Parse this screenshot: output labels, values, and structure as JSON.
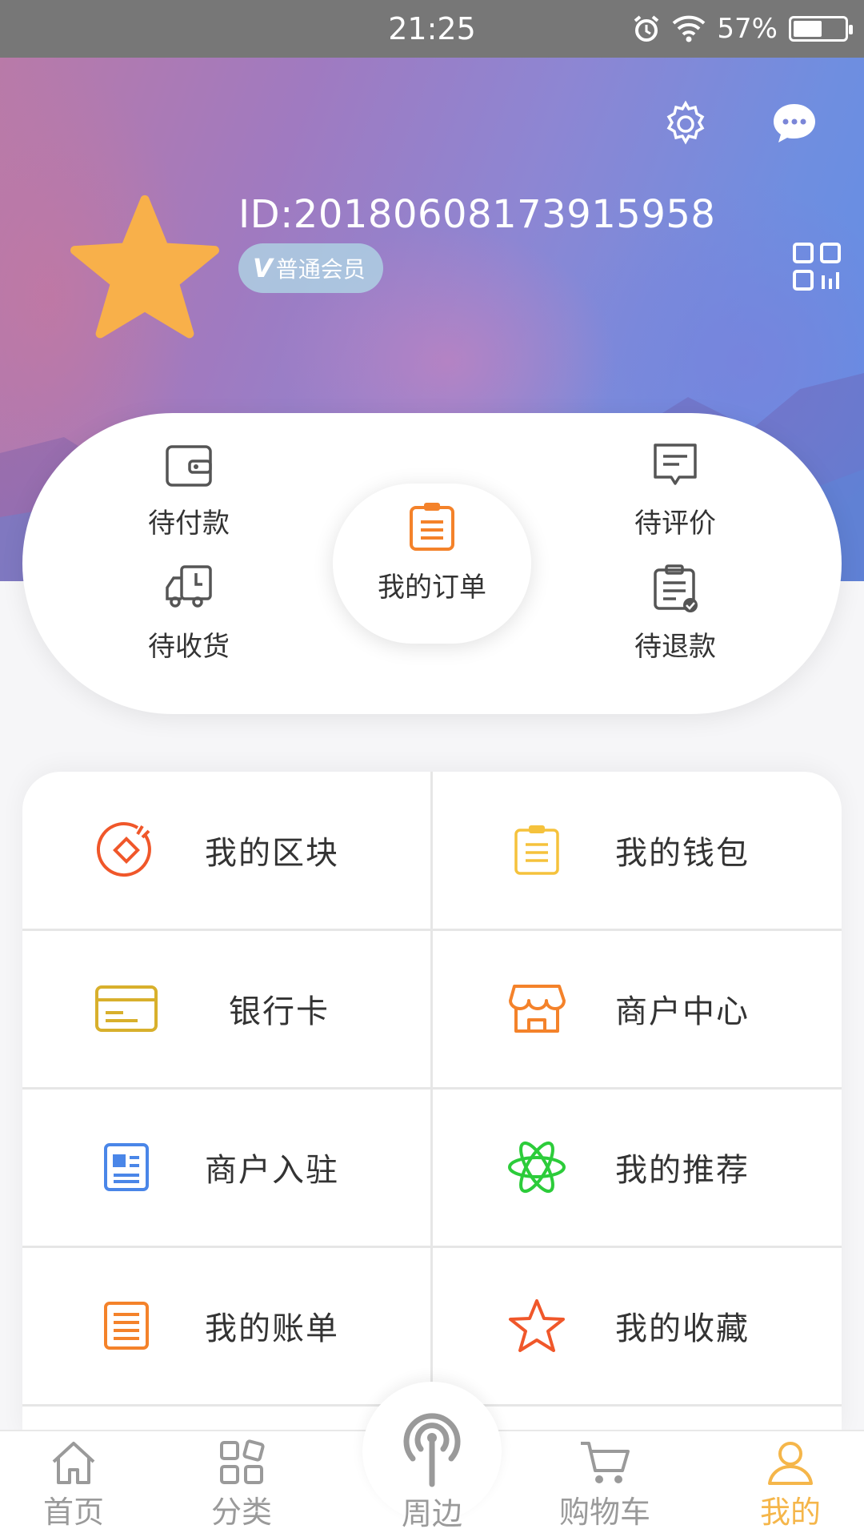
{
  "status_bar": {
    "time": "21:25",
    "battery": "57%",
    "battery_level": 0.57
  },
  "profile": {
    "id": "ID:20180608173915958",
    "member_badge_mark": "V",
    "member_level": "普通会员"
  },
  "orders": {
    "pending_payment": "待付款",
    "pending_review": "待评价",
    "my_orders": "我的订单",
    "pending_receipt": "待收货",
    "pending_refund": "待退款"
  },
  "menu": [
    {
      "label": "我的区块",
      "icon": "block-icon",
      "color": "#f0572a"
    },
    {
      "label": "我的钱包",
      "icon": "wallet-icon",
      "color": "#f5c23c"
    },
    {
      "label": "银行卡",
      "icon": "bank-card-icon",
      "color": "#d8b02c"
    },
    {
      "label": "商户中心",
      "icon": "store-icon",
      "color": "#f4822a"
    },
    {
      "label": "商户入驻",
      "icon": "merchant-join-icon",
      "color": "#4a86e8"
    },
    {
      "label": "我的推荐",
      "icon": "recommend-icon",
      "color": "#2ccc3a"
    },
    {
      "label": "我的账单",
      "icon": "bill-icon",
      "color": "#f4822a"
    },
    {
      "label": "我的收藏",
      "icon": "favorite-star-icon",
      "color": "#f0572a"
    }
  ],
  "tabs": [
    {
      "label": "首页",
      "icon": "home-icon"
    },
    {
      "label": "分类",
      "icon": "category-icon"
    },
    {
      "label": "周边",
      "icon": "nearby-signal-icon"
    },
    {
      "label": "购物车",
      "icon": "cart-icon"
    },
    {
      "label": "我的",
      "icon": "profile-icon",
      "active": true
    }
  ],
  "colors": {
    "accent": "#f5b64a",
    "order_icon": "#f4822a",
    "status_bar": "#777777"
  }
}
